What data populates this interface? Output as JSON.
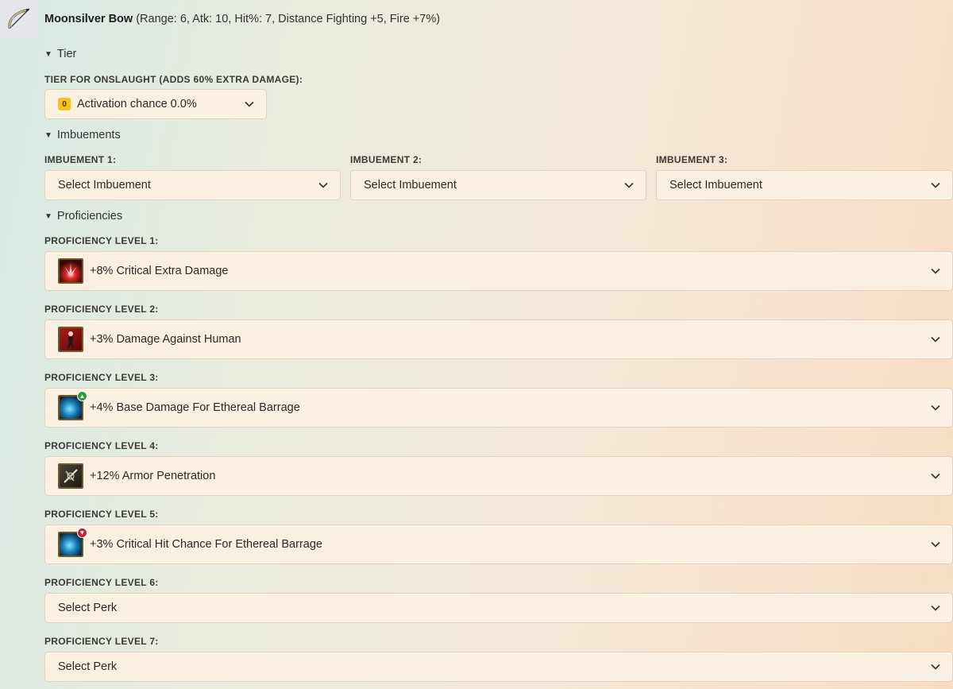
{
  "item": {
    "name": "Moonsilver Bow",
    "stats": "(Range: 6, Atk: 10, Hit%: 7, Distance Fighting +5, Fire +7%)",
    "icon": "bow-icon"
  },
  "sections": {
    "tier": "Tier",
    "imbuements": "Imbuements",
    "proficiencies": "Proficiencies"
  },
  "tier": {
    "label": "TIER FOR ONSLAUGHT (ADDS 60% EXTRA DAMAGE):",
    "badge": "0",
    "value": "Activation chance 0.0%"
  },
  "imbuements": [
    {
      "label": "IMBUEMENT 1:",
      "value": "Select Imbuement"
    },
    {
      "label": "IMBUEMENT 2:",
      "value": "Select Imbuement"
    },
    {
      "label": "IMBUEMENT 3:",
      "value": "Select Imbuement"
    }
  ],
  "proficiencies": [
    {
      "label": "PROFICIENCY LEVEL 1:",
      "value": "+8% Critical Extra Damage",
      "icon": "critical-damage-icon"
    },
    {
      "label": "PROFICIENCY LEVEL 2:",
      "value": "+3% Damage Against Human",
      "icon": "human-target-icon"
    },
    {
      "label": "PROFICIENCY LEVEL 3:",
      "value": "+4% Base Damage For Ethereal Barrage",
      "icon": "ethereal-barrage-icon"
    },
    {
      "label": "PROFICIENCY LEVEL 4:",
      "value": "+12% Armor Penetration",
      "icon": "armor-penetration-icon"
    },
    {
      "label": "PROFICIENCY LEVEL 5:",
      "value": "+3% Critical Hit Chance For Ethereal Barrage",
      "icon": "ethereal-barrage-icon"
    },
    {
      "label": "PROFICIENCY LEVEL 6:",
      "value": "Select Perk"
    },
    {
      "label": "PROFICIENCY LEVEL 7:",
      "value": "Select Perk"
    }
  ],
  "colors": {
    "select_bg": "#faf0e2",
    "select_border": "#e0d3c0",
    "tier_badge": "#f2c318"
  }
}
